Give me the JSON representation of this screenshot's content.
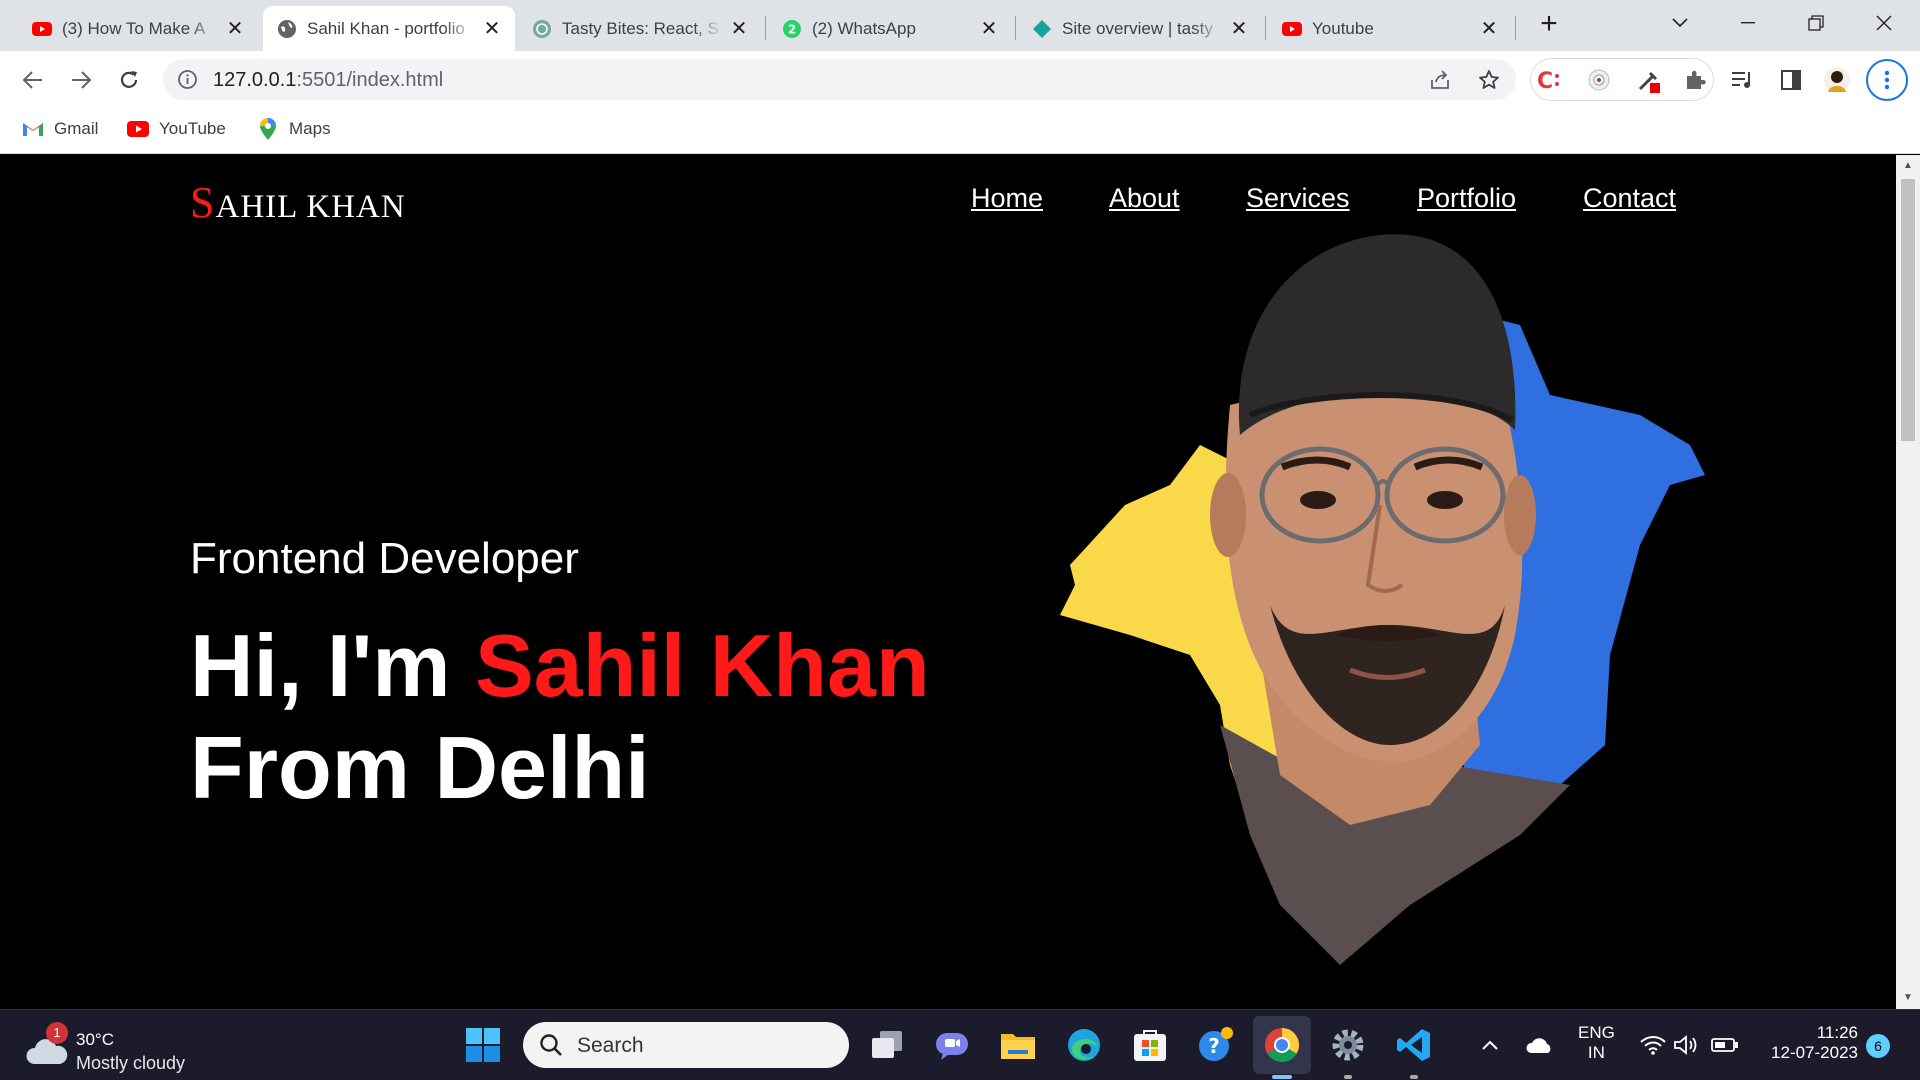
{
  "browser": {
    "tabs": [
      {
        "title": "(3) How To Make A",
        "icon": "youtube-icon",
        "active": false
      },
      {
        "title": "Sahil Khan - portfolio",
        "icon": "globe-icon",
        "active": true
      },
      {
        "title": "Tasty Bites: React, S",
        "icon": "chatgpt-icon",
        "active": false
      },
      {
        "title": "(2) WhatsApp",
        "icon": "whatsapp-icon",
        "active": false
      },
      {
        "title": "Site overview | tasty",
        "icon": "netlify-icon",
        "active": false
      },
      {
        "title": "Youtube",
        "icon": "youtube-icon",
        "active": false
      }
    ],
    "new_tab": "+",
    "url_host": "127.0.0.1",
    "url_path": ":5501/index.html",
    "bookmarks": [
      {
        "label": "Gmail",
        "icon": "gmail-icon"
      },
      {
        "label": "YouTube",
        "icon": "youtube-icon"
      },
      {
        "label": "Maps",
        "icon": "maps-pin-icon"
      }
    ]
  },
  "site": {
    "logo_initial": "S",
    "logo_rest": "AHIL KHAN",
    "nav": [
      "Home",
      "About",
      "Services",
      "Portfolio",
      "Contact"
    ],
    "role": "Frontend Developer",
    "greeting": "Hi, I'm ",
    "name": "Sahil Khan",
    "location_line": "From Delhi",
    "accent_color": "#ff1a1a",
    "blob_colors": {
      "yellow": "#f9d84a",
      "blue": "#2f6fe0"
    }
  },
  "taskbar": {
    "weather_temp": "30°C",
    "weather_desc": "Mostly cloudy",
    "weather_badge": "1",
    "search_label": "Search",
    "lang_top": "ENG",
    "lang_bottom": "IN",
    "time": "11:26",
    "date": "12-07-2023",
    "notifications": "6"
  }
}
